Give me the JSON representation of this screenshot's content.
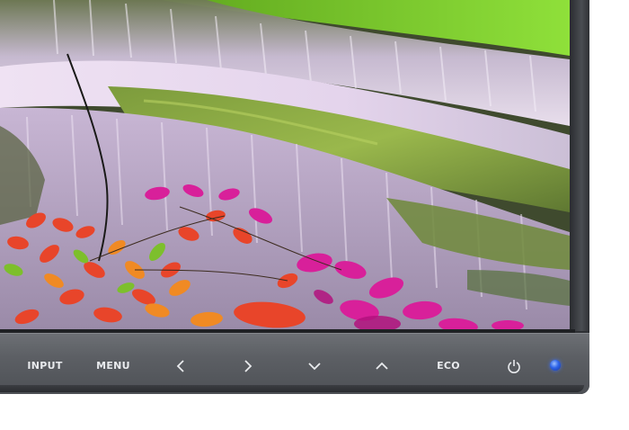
{
  "controls": {
    "input_label": "INPUT",
    "menu_label": "MENU",
    "eco_label": "ECO",
    "left_icon": "chevron-left-icon",
    "right_icon": "chevron-right-icon",
    "down_icon": "chevron-down-icon",
    "up_icon": "chevron-up-icon",
    "power_icon": "power-icon",
    "led_color": "#2d63e8"
  },
  "colors": {
    "bezel": "#5c5f64",
    "button_text": "#e9ebee",
    "moss": "#6fbf2a",
    "water": "#e8dcf0",
    "leaf_red": "#e8452a",
    "leaf_magenta": "#d8209a"
  }
}
